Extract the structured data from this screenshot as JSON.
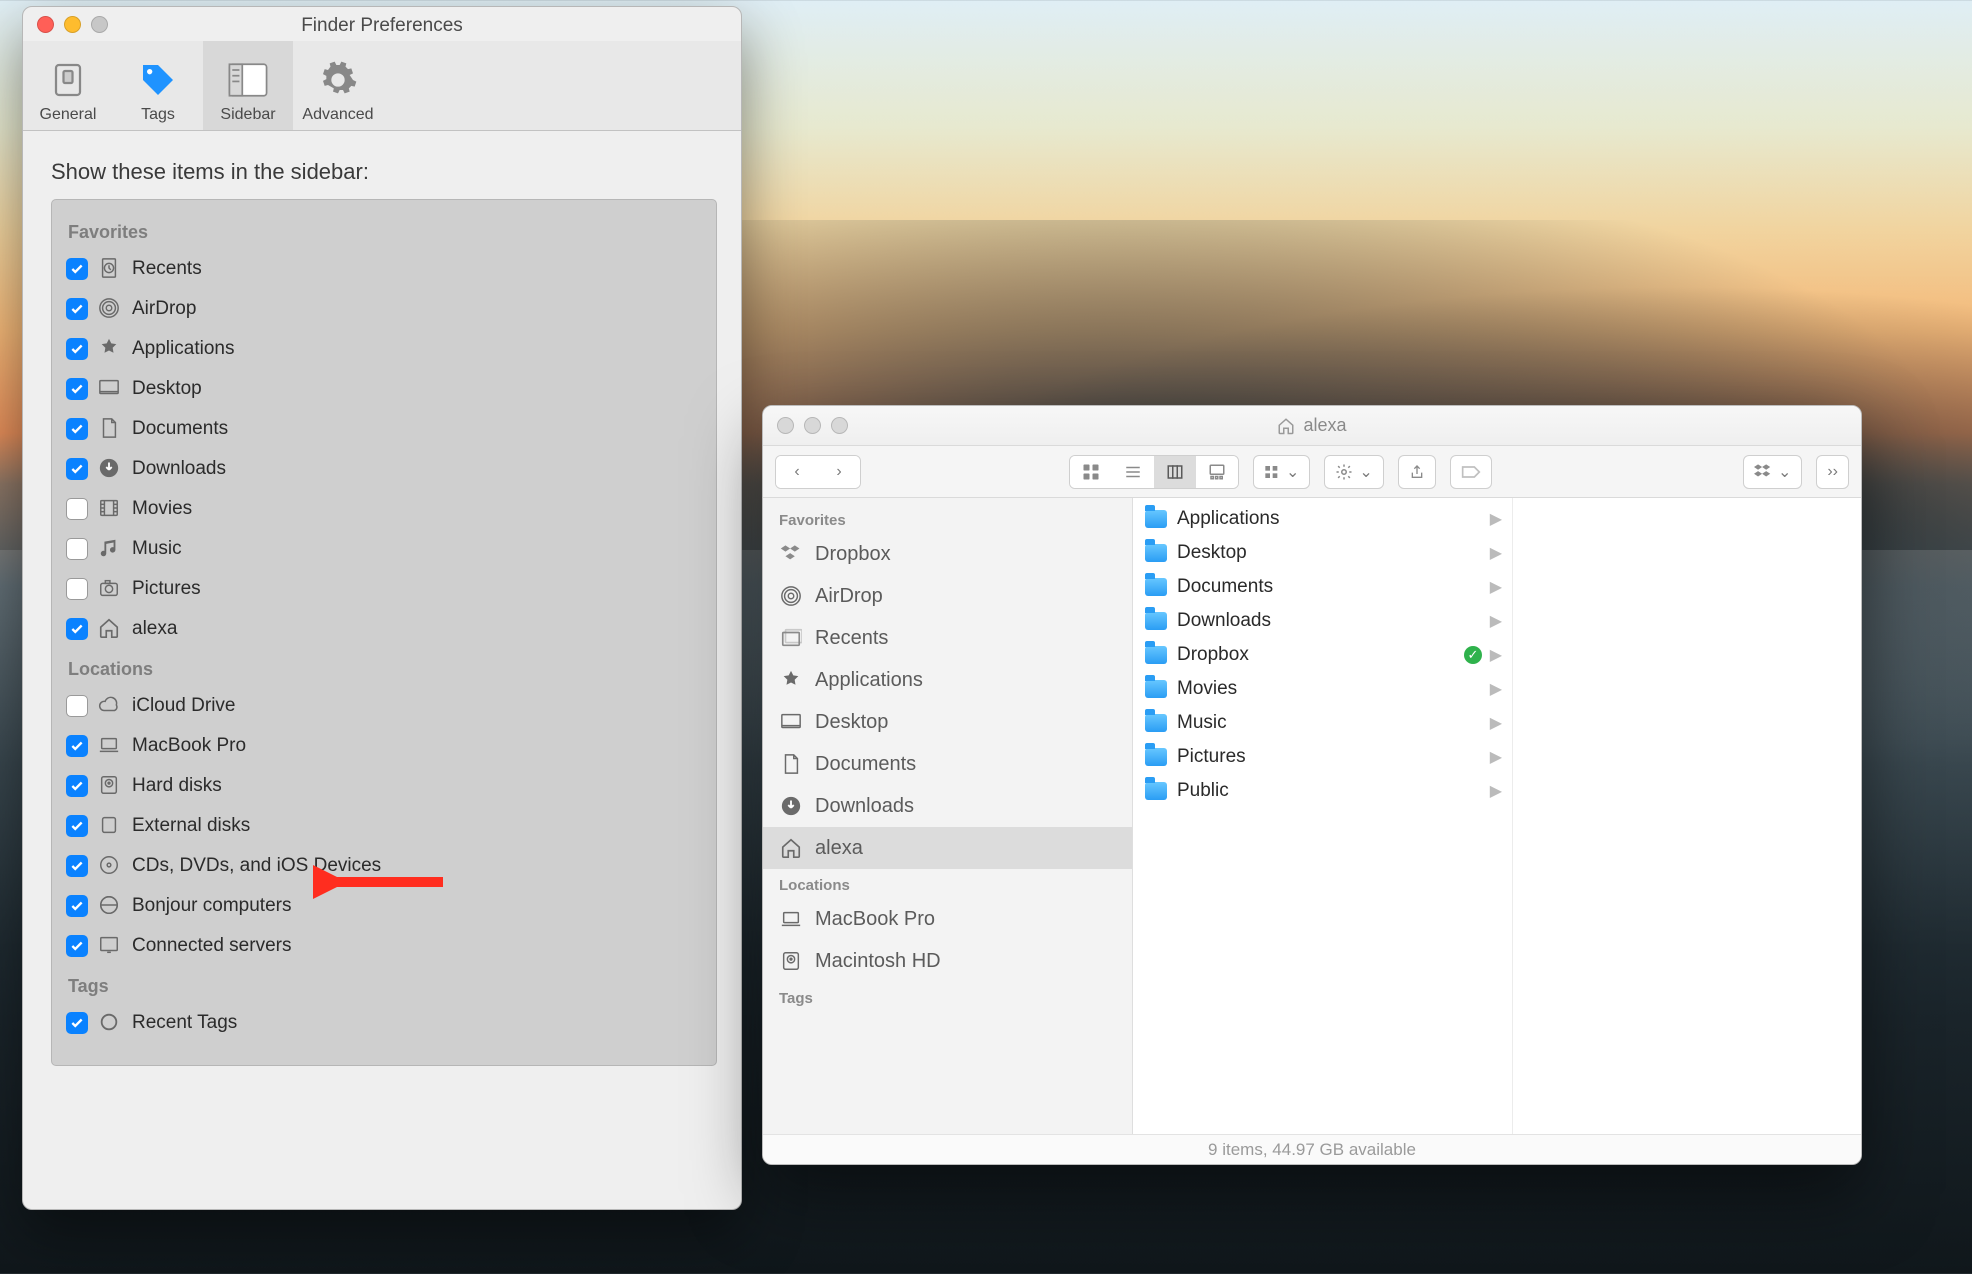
{
  "prefs": {
    "title": "Finder Preferences",
    "tabs": [
      {
        "label": "General",
        "icon": "switch"
      },
      {
        "label": "Tags",
        "icon": "tag"
      },
      {
        "label": "Sidebar",
        "icon": "sidebar",
        "selected": true
      },
      {
        "label": "Advanced",
        "icon": "gear"
      }
    ],
    "section_title": "Show these items in the sidebar:",
    "groups": [
      {
        "header": "Favorites",
        "items": [
          {
            "label": "Recents",
            "icon": "clock-doc",
            "checked": true
          },
          {
            "label": "AirDrop",
            "icon": "airdrop",
            "checked": true
          },
          {
            "label": "Applications",
            "icon": "apps",
            "checked": true
          },
          {
            "label": "Desktop",
            "icon": "desktop",
            "checked": true
          },
          {
            "label": "Documents",
            "icon": "document",
            "checked": true
          },
          {
            "label": "Downloads",
            "icon": "download",
            "checked": true
          },
          {
            "label": "Movies",
            "icon": "movie",
            "checked": false
          },
          {
            "label": "Music",
            "icon": "music",
            "checked": false
          },
          {
            "label": "Pictures",
            "icon": "camera",
            "checked": false
          },
          {
            "label": "alexa",
            "icon": "home",
            "checked": true
          }
        ]
      },
      {
        "header": "Locations",
        "items": [
          {
            "label": "iCloud Drive",
            "icon": "cloud",
            "checked": false
          },
          {
            "label": "MacBook Pro",
            "icon": "laptop",
            "checked": true
          },
          {
            "label": "Hard disks",
            "icon": "hdd",
            "checked": true,
            "highlight": true
          },
          {
            "label": "External disks",
            "icon": "ext",
            "checked": true
          },
          {
            "label": "CDs, DVDs, and iOS Devices",
            "icon": "disc",
            "checked": true
          },
          {
            "label": "Bonjour computers",
            "icon": "bonjour",
            "checked": true
          },
          {
            "label": "Connected servers",
            "icon": "server",
            "checked": true
          }
        ]
      },
      {
        "header": "Tags",
        "items": [
          {
            "label": "Recent Tags",
            "icon": "circle",
            "checked": true
          }
        ]
      }
    ]
  },
  "finder": {
    "title": "alexa",
    "sidebar": {
      "sections": [
        {
          "header": "Favorites",
          "items": [
            {
              "label": "Dropbox",
              "icon": "dropbox"
            },
            {
              "label": "AirDrop",
              "icon": "airdrop"
            },
            {
              "label": "Recents",
              "icon": "recents"
            },
            {
              "label": "Applications",
              "icon": "apps"
            },
            {
              "label": "Desktop",
              "icon": "desktop"
            },
            {
              "label": "Documents",
              "icon": "document"
            },
            {
              "label": "Downloads",
              "icon": "download"
            },
            {
              "label": "alexa",
              "icon": "home",
              "selected": true
            }
          ]
        },
        {
          "header": "Locations",
          "items": [
            {
              "label": "MacBook Pro",
              "icon": "laptop"
            },
            {
              "label": "Macintosh HD",
              "icon": "hdd"
            }
          ]
        },
        {
          "header": "Tags",
          "items": []
        }
      ]
    },
    "column": [
      {
        "label": "Applications"
      },
      {
        "label": "Desktop"
      },
      {
        "label": "Documents"
      },
      {
        "label": "Downloads"
      },
      {
        "label": "Dropbox",
        "synced": true
      },
      {
        "label": "Movies"
      },
      {
        "label": "Music"
      },
      {
        "label": "Pictures"
      },
      {
        "label": "Public"
      }
    ],
    "status": "9 items, 44.97 GB available"
  }
}
